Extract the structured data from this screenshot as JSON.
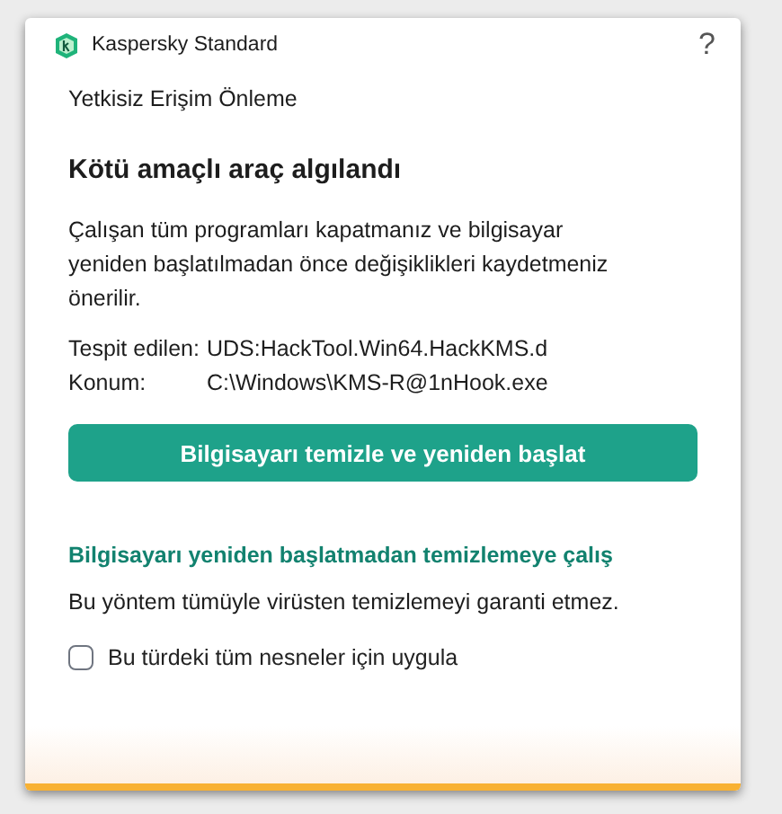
{
  "window": {
    "title": "Kaspersky Standard",
    "help": "?"
  },
  "section": "Yetkisiz Erişim Önleme",
  "heading": "Kötü amaçlı araç algılandı",
  "message": "Çalışan tüm programları kapatmanız ve bilgisayar yeniden başlatılmadan önce değişiklikleri kaydetmeniz önerilir.",
  "details": [
    {
      "label": "Tespit edilen:",
      "value": "UDS:HackTool.Win64.HackKMS.d"
    },
    {
      "label": "Konum:",
      "value": "C:\\Windows\\KMS-R@1nHook.exe"
    }
  ],
  "primary_button": "Bilgisayarı temizle ve yeniden başlat",
  "alt_link": "Bilgisayarı yeniden başlatmadan temizlemeye çalış",
  "note": "Bu yöntem tümüyle virüsten temizlemeyi garanti etmez.",
  "checkbox": {
    "label": "Bu türdeki tüm nesneler için uygula",
    "checked": false
  }
}
